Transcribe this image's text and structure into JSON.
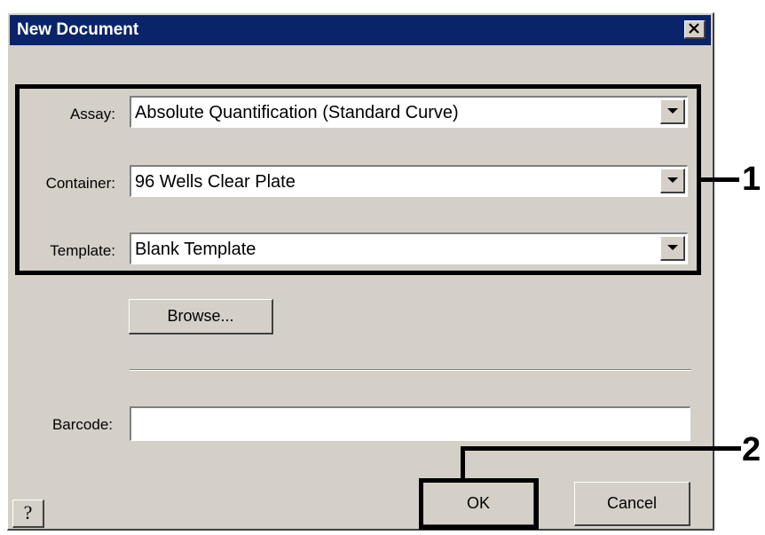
{
  "window": {
    "title": "New Document"
  },
  "form": {
    "assay_label": "Assay:",
    "assay_value": "Absolute Quantification (Standard Curve)",
    "container_label": "Container:",
    "container_value": "96 Wells Clear Plate",
    "template_label": "Template:",
    "template_value": "Blank Template",
    "browse_label": "Browse...",
    "barcode_label": "Barcode:",
    "barcode_value": ""
  },
  "buttons": {
    "ok_label": "OK",
    "cancel_label": "Cancel",
    "help_label": "?"
  },
  "callouts": {
    "one": "1",
    "two": "2"
  },
  "icons": {
    "close": "close-icon",
    "dropdown": "chevron-down-icon",
    "help": "help-icon"
  }
}
